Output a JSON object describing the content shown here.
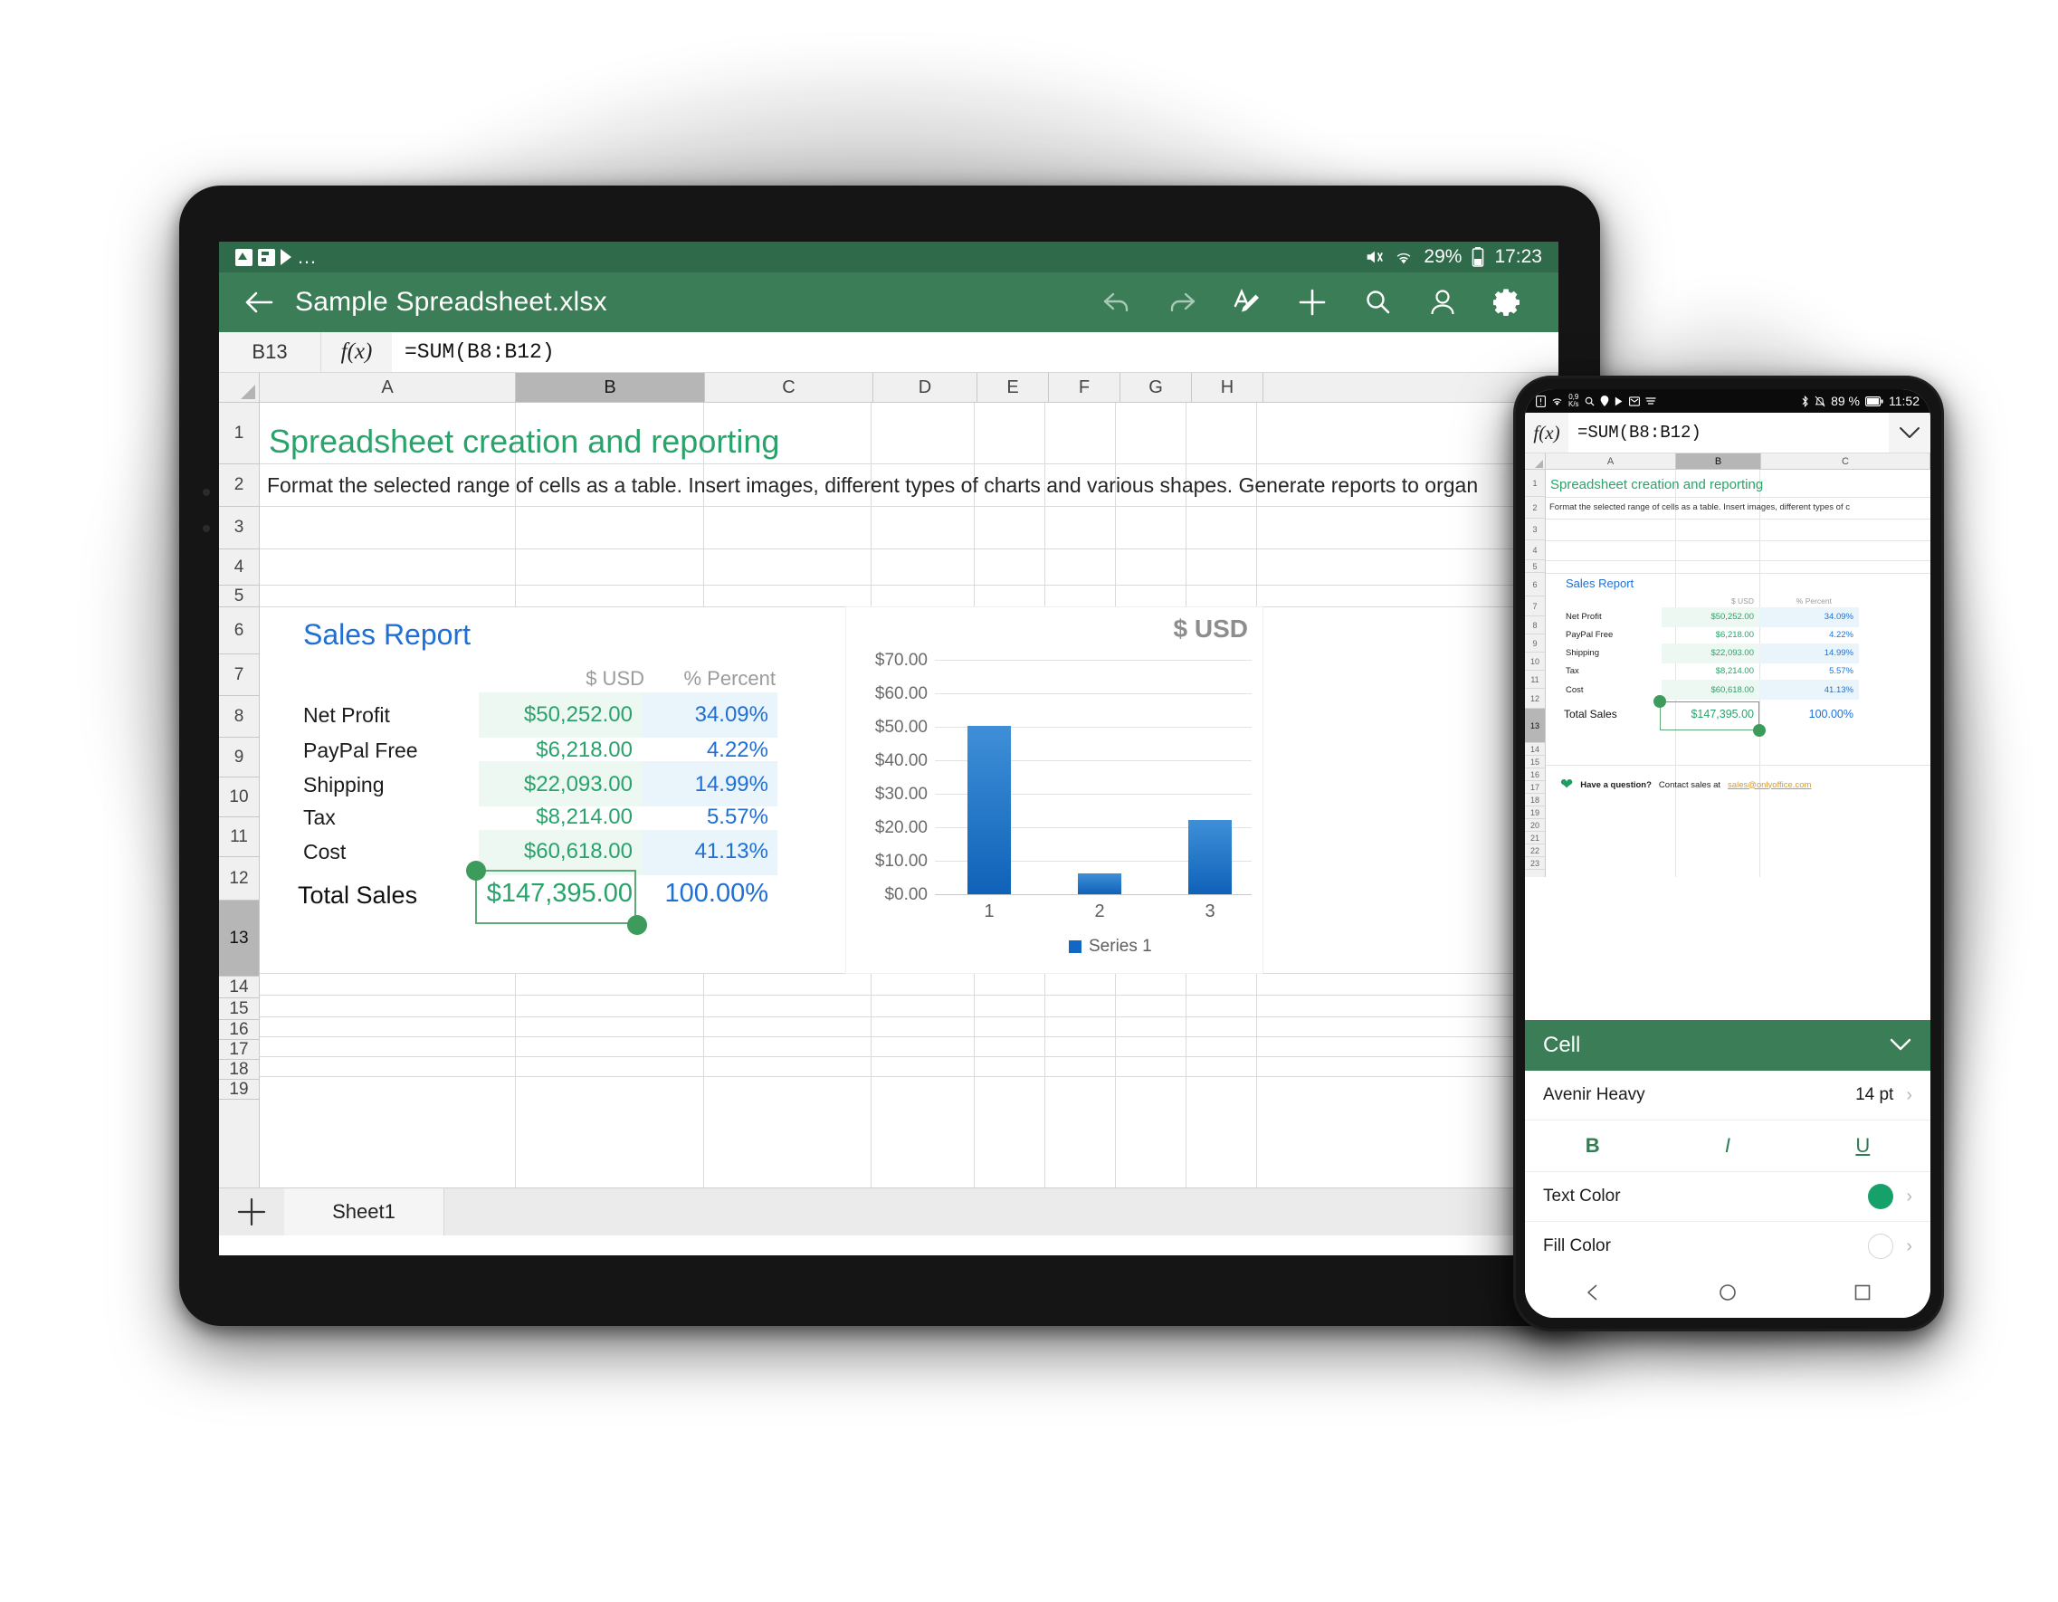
{
  "tablet": {
    "status_bar": {
      "icons": [
        "image-icon",
        "flag-icon",
        "play-icon",
        "more-dots"
      ],
      "battery_percent": "29%",
      "time": "17:23"
    },
    "app_bar": {
      "back_icon": "back-arrow-icon",
      "title": "Sample Spreadsheet.xlsx",
      "actions": [
        "undo-icon",
        "redo-icon",
        "edit-text-icon",
        "plus-icon",
        "search-icon",
        "user-icon",
        "settings-gear-icon"
      ]
    },
    "formula_bar": {
      "cell_ref": "B13",
      "fx_label": "f(x)",
      "formula": "=SUM(B8:B12)"
    },
    "grid": {
      "columns": [
        "A",
        "B",
        "C",
        "D",
        "E",
        "F",
        "G",
        "H"
      ],
      "selected_column": "B",
      "rows": [
        "1",
        "2",
        "3",
        "4",
        "5",
        "6",
        "7",
        "8",
        "9",
        "10",
        "11",
        "12",
        "13",
        "14",
        "15",
        "16",
        "17",
        "18",
        "19"
      ],
      "selected_row": "13",
      "a1_title": "Spreadsheet creation and reporting",
      "a2_text": "Format the selected range of cells as a table. Insert images, different types of charts and various shapes. Generate reports to organ"
    },
    "sales_report": {
      "title": "Sales Report",
      "col_usd": "$ USD",
      "col_percent": "% Percent",
      "rows": [
        {
          "label": "Net Profit",
          "usd": "$50,252.00",
          "percent": "34.09%"
        },
        {
          "label": "PayPal Free",
          "usd": "$6,218.00",
          "percent": "4.22%"
        },
        {
          "label": "Shipping",
          "usd": "$22,093.00",
          "percent": "14.99%"
        },
        {
          "label": "Tax",
          "usd": "$8,214.00",
          "percent": "5.57%"
        },
        {
          "label": "Cost",
          "usd": "$60,618.00",
          "percent": "41.13%"
        }
      ],
      "total": {
        "label": "Total Sales",
        "usd": "$147,395.00",
        "percent": "100.00%"
      }
    },
    "sheet_bar": {
      "add_icon": "plus-icon",
      "tabs": [
        "Sheet1"
      ]
    }
  },
  "chart_data": {
    "type": "bar",
    "title": "$ USD",
    "categories": [
      "1",
      "2",
      "3"
    ],
    "series": [
      {
        "name": "Series 1",
        "values": [
          50.25,
          6.22,
          22.09
        ]
      }
    ],
    "ytick_labels": [
      "$70.00",
      "$60.00",
      "$50.00",
      "$40.00",
      "$30.00",
      "$20.00",
      "$10.00",
      "$0.00"
    ],
    "ytick_values": [
      70,
      60,
      50,
      40,
      30,
      20,
      10,
      0
    ],
    "ylim": [
      0,
      70
    ],
    "xlabel": "",
    "ylabel": "",
    "grid": true,
    "legend": "bottom",
    "legend_entries": [
      "Series 1"
    ],
    "bar_color": "#1266c4"
  },
  "phone": {
    "status_bar": {
      "left_icons": [
        "sim-icon",
        "wifi-icon",
        "search-icon",
        "location-icon",
        "play-icon",
        "mail-icon",
        "menu-icon"
      ],
      "data_rate": "0,9",
      "data_unit": "K/s",
      "right_icons": [
        "bluetooth-icon",
        "mute-icon",
        "battery-icon"
      ],
      "battery_percent": "89 %",
      "time": "11:52"
    },
    "formula_bar": {
      "fx_label": "f(x)",
      "formula": "=SUM(B8:B12)",
      "chevron_icon": "chevron-down-icon"
    },
    "grid": {
      "columns": [
        "A",
        "B",
        "C"
      ],
      "selected_column": "B",
      "rows": [
        "1",
        "2",
        "3",
        "4",
        "5",
        "6",
        "7",
        "8",
        "9",
        "10",
        "11",
        "12",
        "13",
        "14",
        "15",
        "16",
        "17",
        "18",
        "19",
        "20",
        "21",
        "22",
        "23"
      ],
      "selected_row": "13",
      "a1_title": "Spreadsheet creation and reporting",
      "a2_text": "Format the selected range of cells as a table. Insert images, different types of c"
    },
    "sales_report": {
      "title": "Sales Report",
      "col_usd": "$ USD",
      "col_percent": "% Percent",
      "rows": [
        {
          "label": "Net Profit",
          "usd": "$50,252.00",
          "percent": "34.09%"
        },
        {
          "label": "PayPal Free",
          "usd": "$6,218.00",
          "percent": "4.22%"
        },
        {
          "label": "Shipping",
          "usd": "$22,093.00",
          "percent": "14.99%"
        },
        {
          "label": "Tax",
          "usd": "$8,214.00",
          "percent": "5.57%"
        },
        {
          "label": "Cost",
          "usd": "$60,618.00",
          "percent": "41.13%"
        }
      ],
      "total": {
        "label": "Total Sales",
        "usd": "$147,395.00",
        "percent": "100.00%"
      }
    },
    "banner": {
      "heart_icon": "heart-icon",
      "question": "Have a question?",
      "text": "Contact sales at",
      "email": "sales@onlyoffice.com"
    },
    "panel": {
      "title": "Cell",
      "collapse_icon": "chevron-down-icon",
      "font_name": "Avenir Heavy",
      "font_size": "14 pt",
      "bold_label": "B",
      "italic_label": "I",
      "underline_label": "U",
      "text_color_label": "Text Color",
      "text_color_value": "#16a06a",
      "fill_color_label": "Fill Color",
      "fill_color_value": "#ffffff"
    },
    "nav_bar": {
      "back_icon": "triangle-back-icon",
      "home_icon": "circle-home-icon",
      "recents_icon": "square-recents-icon"
    }
  },
  "colors": {
    "brand_green": "#3a7d56",
    "accent_green": "#2aa36b",
    "accent_blue": "#1f6fd4",
    "bar_blue": "#1266c4",
    "selection_green": "#3d9c5c"
  }
}
